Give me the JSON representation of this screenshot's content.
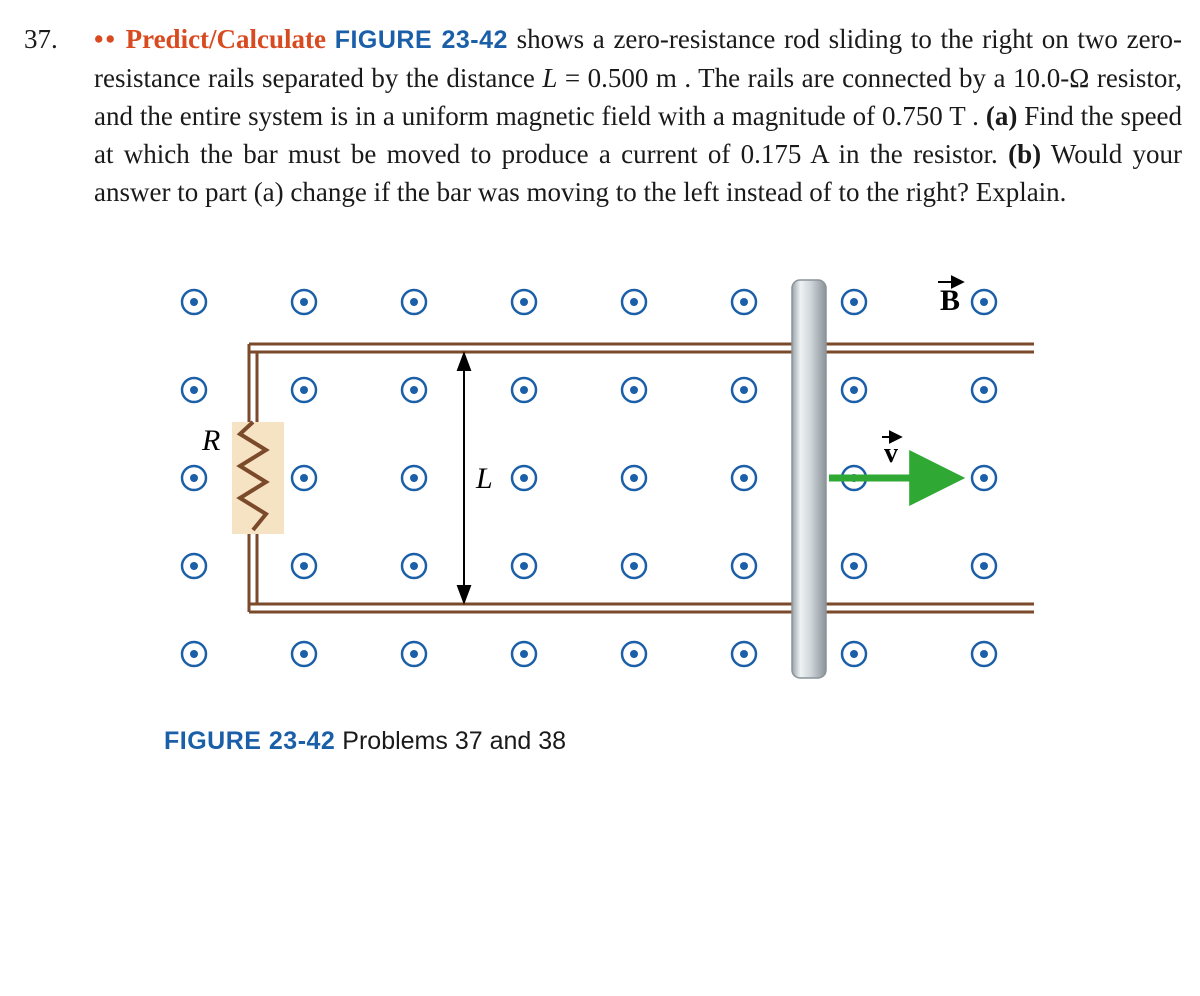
{
  "problem": {
    "number": "37.",
    "dots": "••",
    "predict": "Predict/Calculate",
    "figref": "FIGURE 23-42",
    "text1": " shows a zero-resistance rod sliding to the right on two zero-resistance rails separated by the distance ",
    "var_L": "L",
    "eq": " = ",
    "val_L": "0.500 m",
    "text2": ". The rails are connected by a ",
    "val_R": "10.0-Ω",
    "text3": " resistor, and the entire system is in a uniform magnetic field with a magnitude of ",
    "val_B": "0.750 T",
    "text4": ". ",
    "part_a": "(a)",
    "text5": " Find the speed at which the bar must be moved to produce a current of ",
    "val_I": "0.175 A",
    "text6": " in the resistor. ",
    "part_b": "(b)",
    "text7": " Would your answer to part (a) change if the bar was moving to the left instead of to the right? Explain."
  },
  "figure": {
    "label_R": "R",
    "label_L": "L",
    "label_B": "B",
    "label_v": "v",
    "caption_fig": "FIGURE 23-42",
    "caption_text": "  Problems 37 and 38"
  }
}
